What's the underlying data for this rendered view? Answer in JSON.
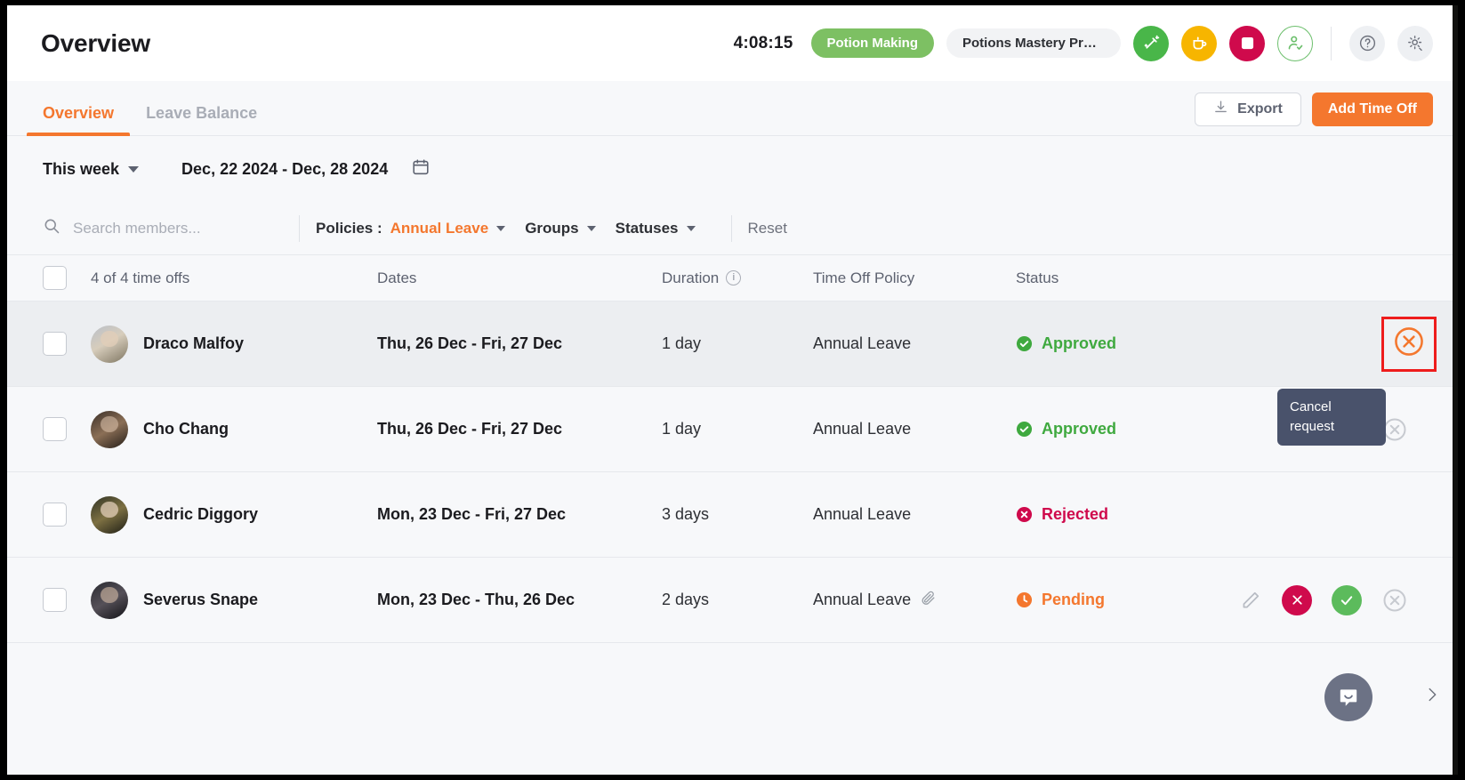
{
  "header": {
    "title": "Overview",
    "timer": "4:08:15",
    "task_pill": "Potion Making",
    "project_pill": "Potions Mastery Progr...",
    "icons": {
      "tool": "wand-icon",
      "break": "coffee-cup-icon",
      "stop": "stop-square-icon",
      "attendance": "user-check-icon",
      "help": "question-mark-icon",
      "settings": "gear-settings-icon"
    }
  },
  "tabs": [
    {
      "label": "Overview",
      "active": true
    },
    {
      "label": "Leave Balance",
      "active": false
    }
  ],
  "actions": {
    "export_label": "Export",
    "add_time_off_label": "Add Time Off"
  },
  "daterow": {
    "period_label": "This week",
    "range_label": "Dec, 22 2024 - Dec, 28 2024",
    "calendar_icon": "calendar-icon"
  },
  "filters": {
    "search_placeholder": "Search members...",
    "search_value": "",
    "policies_label": "Policies :",
    "policies_value": "Annual Leave",
    "groups_label": "Groups",
    "statuses_label": "Statuses",
    "reset_label": "Reset"
  },
  "table": {
    "columns": {
      "count": "4 of 4 time offs",
      "dates": "Dates",
      "duration": "Duration",
      "policy": "Time Off Policy",
      "status": "Status"
    },
    "rows": [
      {
        "name": "Draco Malfoy",
        "avatar": "av-draco",
        "dates": "Thu, 26 Dec - Fri, 27 Dec",
        "duration": "1 day",
        "policy": "Annual Leave",
        "has_attachment": false,
        "status": "Approved",
        "status_kind": "approved",
        "highlighted": true,
        "row_actions": [
          "cancel"
        ]
      },
      {
        "name": "Cho Chang",
        "avatar": "av-cho",
        "dates": "Thu, 26 Dec - Fri, 27 Dec",
        "duration": "1 day",
        "policy": "Annual Leave",
        "has_attachment": false,
        "status": "Approved",
        "status_kind": "approved",
        "highlighted": false,
        "row_actions": [
          "cancel"
        ]
      },
      {
        "name": "Cedric Diggory",
        "avatar": "av-cedric",
        "dates": "Mon, 23 Dec - Fri, 27 Dec",
        "duration": "3 days",
        "policy": "Annual Leave",
        "has_attachment": false,
        "status": "Rejected",
        "status_kind": "rejected",
        "highlighted": false,
        "row_actions": []
      },
      {
        "name": "Severus Snape",
        "avatar": "av-snape",
        "dates": "Mon, 23 Dec - Thu, 26 Dec",
        "duration": "2 days",
        "policy": "Annual Leave",
        "has_attachment": true,
        "status": "Pending",
        "status_kind": "pending",
        "highlighted": false,
        "row_actions": [
          "edit",
          "reject",
          "approve",
          "cancel"
        ]
      }
    ]
  },
  "tooltip": {
    "text": "Cancel request"
  },
  "widgets": {
    "intercom_icon": "chat-bubble-icon",
    "collapse_icon": "chevron-right-icon"
  },
  "colors": {
    "accent": "#f4772e",
    "approved": "#3fa93f",
    "rejected": "#cf0a4c",
    "pending": "#f4772e",
    "highlight_box": "#ee1c1c",
    "tooltip_bg": "#49526b"
  }
}
